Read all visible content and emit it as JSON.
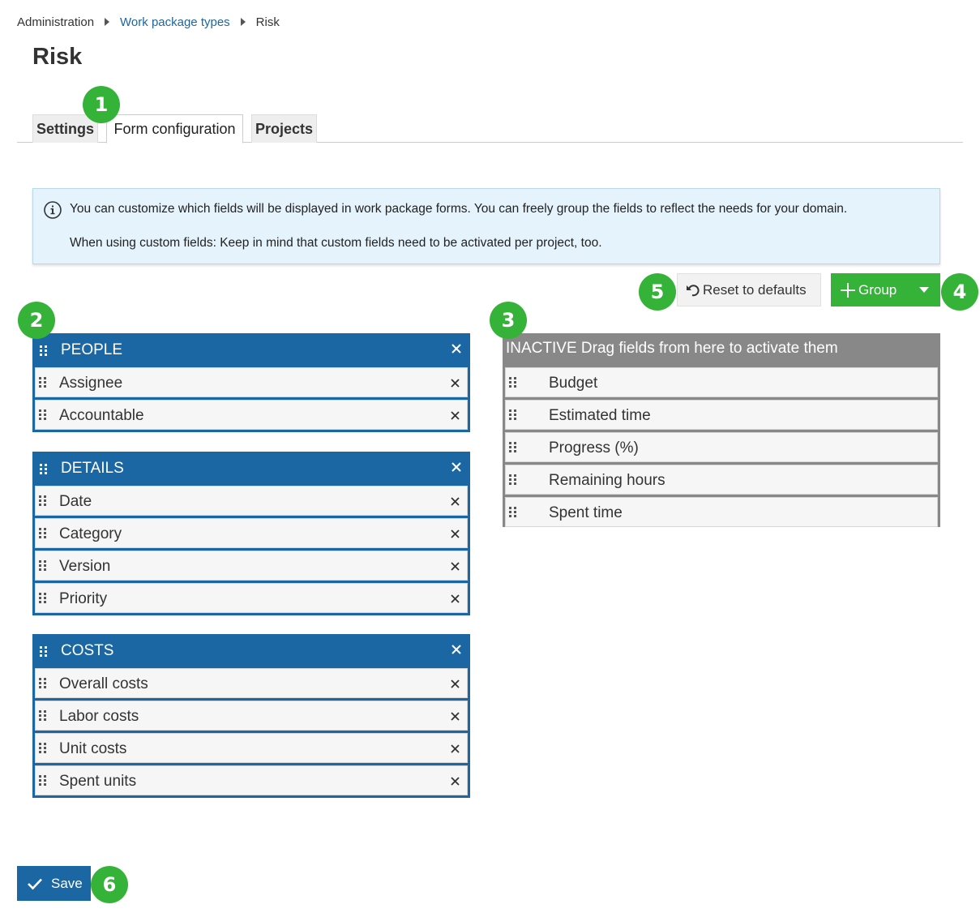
{
  "breadcrumb": {
    "items": [
      "Administration",
      "Work package types",
      "Risk"
    ]
  },
  "page": {
    "title": "Risk"
  },
  "tabs": [
    {
      "label": "Settings",
      "active": false
    },
    {
      "label": "Form configuration",
      "active": true
    },
    {
      "label": "Projects",
      "active": false
    }
  ],
  "info": {
    "line1": "You can customize which fields will be displayed in work package forms. You can freely group the fields to reflect the needs for your domain.",
    "line2": "When using custom fields: Keep in mind that custom fields need to be activated per project, too."
  },
  "toolbar": {
    "reset_label": "Reset to defaults",
    "group_label": "Group"
  },
  "groups": [
    {
      "name": "PEOPLE",
      "fields": [
        "Assignee",
        "Accountable"
      ]
    },
    {
      "name": "DETAILS",
      "fields": [
        "Date",
        "Category",
        "Version",
        "Priority"
      ]
    },
    {
      "name": "COSTS",
      "fields": [
        "Overall costs",
        "Labor costs",
        "Unit costs",
        "Spent units"
      ]
    }
  ],
  "inactive": {
    "header": "INACTIVE Drag fields from here to activate them",
    "fields": [
      "Budget",
      "Estimated time",
      "Progress (%)",
      "Remaining hours",
      "Spent time"
    ]
  },
  "save_label": "Save",
  "badges": [
    "1",
    "2",
    "3",
    "4",
    "5",
    "6"
  ],
  "colors": {
    "primary": "#1a67a3",
    "accent_green": "#35b339",
    "inactive_gray": "#888888",
    "info_bg": "#e5f4fc"
  }
}
